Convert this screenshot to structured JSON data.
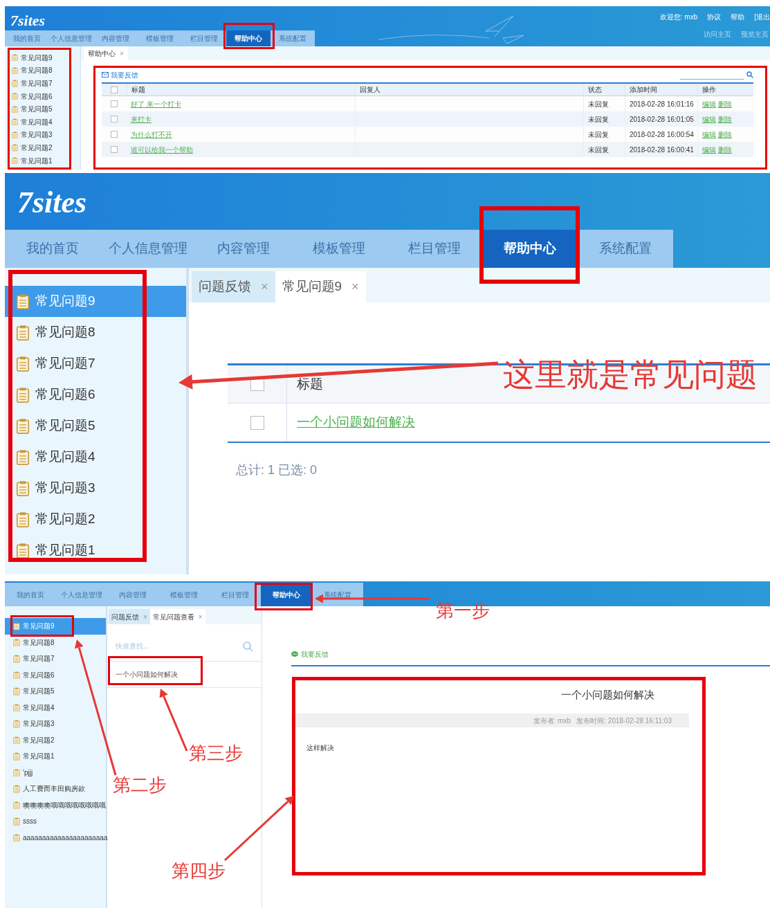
{
  "panels": [
    {
      "kind": "list",
      "header": {
        "logo": "7sites",
        "user_links": [
          "欢迎您: mxb",
          "协议",
          "帮助",
          "[退出"
        ],
        "site_links": [
          "访问主页",
          "预览主页"
        ]
      },
      "nav": [
        {
          "label": "我的首页",
          "selected": false
        },
        {
          "label": "个人信息管理",
          "selected": false
        },
        {
          "label": "内容管理",
          "selected": false
        },
        {
          "label": "模板管理",
          "selected": false
        },
        {
          "label": "栏目管理",
          "selected": false
        },
        {
          "label": "帮助中心",
          "selected": true
        },
        {
          "label": "系统配置",
          "selected": false
        }
      ],
      "sidebar": [
        {
          "label": "常见问题9",
          "selected": false
        },
        {
          "label": "常见问题8",
          "selected": false
        },
        {
          "label": "常见问题7",
          "selected": false
        },
        {
          "label": "常见问题6",
          "selected": false
        },
        {
          "label": "常见问题5",
          "selected": false
        },
        {
          "label": "常见问题4",
          "selected": false
        },
        {
          "label": "常见问题3",
          "selected": false
        },
        {
          "label": "常见问题2",
          "selected": false
        },
        {
          "label": "常见问题1",
          "selected": false
        }
      ],
      "tabs": [
        {
          "label": "帮助中心",
          "close": "×",
          "selected": true
        }
      ],
      "toolbar": {
        "action": "我要反馈"
      },
      "table": {
        "columns": [
          "标题",
          "回复人",
          "状态",
          "添加时间",
          "操作"
        ],
        "rows": [
          {
            "checked": false,
            "title": "好了 来一个打卡",
            "status": "未回复",
            "time": "2018-02-28 16:01:16",
            "actions": [
              "编辑",
              "删除"
            ]
          },
          {
            "checked": false,
            "title": "来打卡",
            "status": "未回复",
            "time": "2018-02-28 16:01:05",
            "actions": [
              "编辑",
              "删除"
            ]
          },
          {
            "checked": false,
            "title": "为什么打不开",
            "status": "未回复",
            "time": "2018-02-28 16:00:54",
            "actions": [
              "编辑",
              "删除"
            ]
          },
          {
            "checked": false,
            "title": "谁可以给我一个帮助",
            "status": "未回复",
            "time": "2018-02-28 16:00:41",
            "actions": [
              "编辑",
              "删除"
            ]
          }
        ],
        "header_checked": false
      }
    },
    {
      "kind": "grid",
      "header": {
        "logo": "7sites"
      },
      "nav": [
        {
          "label": "我的首页",
          "selected": false
        },
        {
          "label": "个人信息管理",
          "selected": false
        },
        {
          "label": "内容管理",
          "selected": false
        },
        {
          "label": "模板管理",
          "selected": false
        },
        {
          "label": "栏目管理",
          "selected": false
        },
        {
          "label": "帮助中心",
          "selected": true
        },
        {
          "label": "系统配置",
          "selected": false
        }
      ],
      "sidebar": [
        {
          "label": "常见问题9",
          "selected": true
        },
        {
          "label": "常见问题8",
          "selected": false
        },
        {
          "label": "常见问题7",
          "selected": false
        },
        {
          "label": "常见问题6",
          "selected": false
        },
        {
          "label": "常见问题5",
          "selected": false
        },
        {
          "label": "常见问题4",
          "selected": false
        },
        {
          "label": "常见问题3",
          "selected": false
        },
        {
          "label": "常见问题2",
          "selected": false
        },
        {
          "label": "常见问题1",
          "selected": false
        }
      ],
      "tabs": [
        {
          "label": "问题反馈",
          "close": "×",
          "selected": false
        },
        {
          "label": "常见问题9",
          "close": "×",
          "selected": true
        }
      ],
      "table": {
        "columns": [
          "标题"
        ],
        "rows": [
          {
            "checked": false,
            "title": "一个小问题如何解决"
          }
        ],
        "header_checked": false
      },
      "footer": "总计: 1 已选: 0",
      "callouts": [
        {
          "text": "这里就是常见问题"
        }
      ]
    },
    {
      "kind": "detail",
      "nav": [
        {
          "label": "我的首页",
          "selected": false
        },
        {
          "label": "个人信息管理",
          "selected": false
        },
        {
          "label": "内容管理",
          "selected": false
        },
        {
          "label": "模板管理",
          "selected": false
        },
        {
          "label": "栏目管理",
          "selected": false
        },
        {
          "label": "帮助中心",
          "selected": true
        },
        {
          "label": "系统配置",
          "selected": false
        }
      ],
      "sidebar": [
        {
          "label": "常见问题9",
          "selected": true
        },
        {
          "label": "常见问题8",
          "selected": false
        },
        {
          "label": "常见问题7",
          "selected": false
        },
        {
          "label": "常见问题6",
          "selected": false
        },
        {
          "label": "常见问题5",
          "selected": false
        },
        {
          "label": "常见问题4",
          "selected": false
        },
        {
          "label": "常见问题3",
          "selected": false
        },
        {
          "label": "常见问题2",
          "selected": false
        },
        {
          "label": "常见问题1",
          "selected": false
        },
        {
          "label": "'pjjj",
          "selected": false
        },
        {
          "label": "人工费而丰田购房款",
          "selected": false
        },
        {
          "label": "噢噢噢噢哦哦哦哦哦哦哦哦",
          "selected": false
        },
        {
          "label": "ssss",
          "selected": false
        },
        {
          "label": "aaaaaaaaaaaaaaaaaaaaaa",
          "selected": false
        }
      ],
      "tabs": [
        {
          "label": "问题反馈",
          "close": "×",
          "selected": false
        },
        {
          "label": "常见问题查看",
          "close": "×",
          "selected": true
        }
      ],
      "search": {
        "placeholder": "快速查找..."
      },
      "list": [
        {
          "label": "一个小问题如何解决"
        }
      ],
      "toolbar": {
        "action": "我要反馈"
      },
      "article": {
        "title": "一个小问题如何解决",
        "meta": "发布者: mxb   发布时间: 2018-02-28 16:11:03",
        "body": "这样解决"
      },
      "callouts": [
        {
          "text": "第一步"
        },
        {
          "text": "第二步"
        },
        {
          "text": "第三步"
        },
        {
          "text": "第四步"
        }
      ]
    }
  ]
}
